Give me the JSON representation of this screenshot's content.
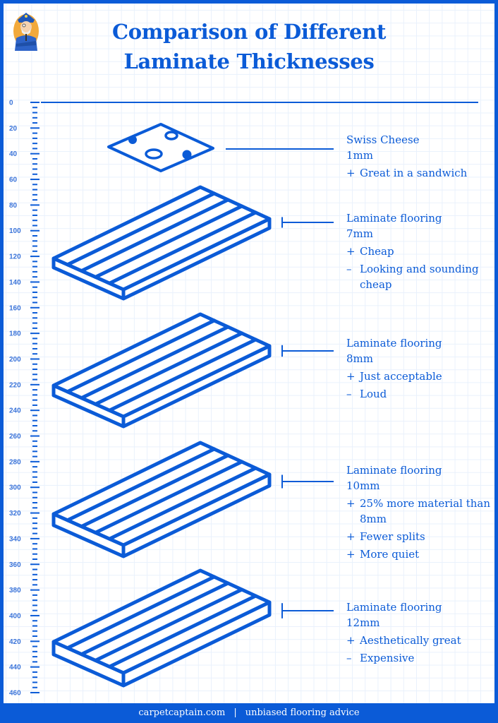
{
  "title": {
    "line1": "Comparison of Different",
    "line2": "Laminate Thicknesses"
  },
  "logo": {
    "icon": "captain-mascot-icon"
  },
  "colors": {
    "brand_blue": "#0b5bd7",
    "grid": "#e9f1fc",
    "ruler_label": "#3b74d9",
    "background": "#ffffff"
  },
  "ruler": {
    "min": 0,
    "max": 460,
    "major_step": 20,
    "minor_step": 4,
    "labels": [
      "0",
      "20",
      "40",
      "60",
      "80",
      "100",
      "120",
      "140",
      "160",
      "180",
      "200",
      "220",
      "240",
      "260",
      "280",
      "300",
      "320",
      "340",
      "360",
      "380",
      "400",
      "420",
      "440",
      "460"
    ]
  },
  "items": [
    {
      "name": "Swiss Cheese",
      "thickness": "1mm",
      "thickness_mm": 1,
      "icon": "swiss-cheese-slice-icon",
      "points": [
        {
          "symbol": "+",
          "text": "Great in a sandwich"
        }
      ]
    },
    {
      "name": "Laminate flooring",
      "thickness": "7mm",
      "thickness_mm": 7,
      "icon": "laminate-plank-icon",
      "points": [
        {
          "symbol": "+",
          "text": "Cheap"
        },
        {
          "symbol": "–",
          "text": "Looking and sounding cheap"
        }
      ]
    },
    {
      "name": "Laminate flooring",
      "thickness": "8mm",
      "thickness_mm": 8,
      "icon": "laminate-plank-icon",
      "points": [
        {
          "symbol": "+",
          "text": "Just acceptable"
        },
        {
          "symbol": "–",
          "text": "Loud"
        }
      ]
    },
    {
      "name": "Laminate flooring",
      "thickness": "10mm",
      "thickness_mm": 10,
      "icon": "laminate-plank-icon",
      "points": [
        {
          "symbol": "+",
          "text": "25% more material than 8mm"
        },
        {
          "symbol": "+",
          "text": "Fewer splits"
        },
        {
          "symbol": "+",
          "text": "More quiet"
        }
      ]
    },
    {
      "name": "Laminate flooring",
      "thickness": "12mm",
      "thickness_mm": 12,
      "icon": "laminate-plank-icon",
      "points": [
        {
          "symbol": "+",
          "text": "Aesthetically great"
        },
        {
          "symbol": "–",
          "text": "Expensive"
        }
      ]
    }
  ],
  "footer": {
    "site": "carpetcaptain.com",
    "separator": "|",
    "tagline": "unbiased flooring advice"
  }
}
